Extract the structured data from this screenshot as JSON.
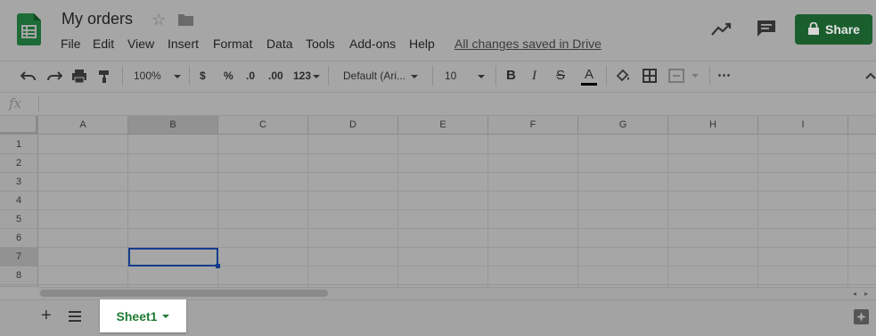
{
  "doc": {
    "title": "My orders",
    "save_status": "All changes saved in Drive"
  },
  "menu": [
    "File",
    "Edit",
    "View",
    "Insert",
    "Format",
    "Data",
    "Tools",
    "Add-ons",
    "Help"
  ],
  "share": {
    "label": "Share"
  },
  "toolbar": {
    "zoom": "100%",
    "currency": "$",
    "percent": "%",
    "decimal_less": ".0",
    "decimal_more": ".00",
    "number_format": "123",
    "font": "Default (Ari...",
    "font_size": "10",
    "bold": "B",
    "italic": "I",
    "strike": "S",
    "text_color": "A",
    "more": "⋯"
  },
  "formula_bar": {
    "fx": "fx",
    "value": ""
  },
  "columns": [
    "A",
    "B",
    "C",
    "D",
    "E",
    "F",
    "G",
    "H",
    "I"
  ],
  "rows": [
    "1",
    "2",
    "3",
    "4",
    "5",
    "6",
    "7",
    "8"
  ],
  "selected_cell": "B7",
  "sheets": [
    {
      "name": "Sheet1",
      "active": true
    }
  ],
  "colors": {
    "share_green": "#1b5e2e",
    "selection_blue": "#143d8a",
    "tab_green": "#1e7b34"
  }
}
